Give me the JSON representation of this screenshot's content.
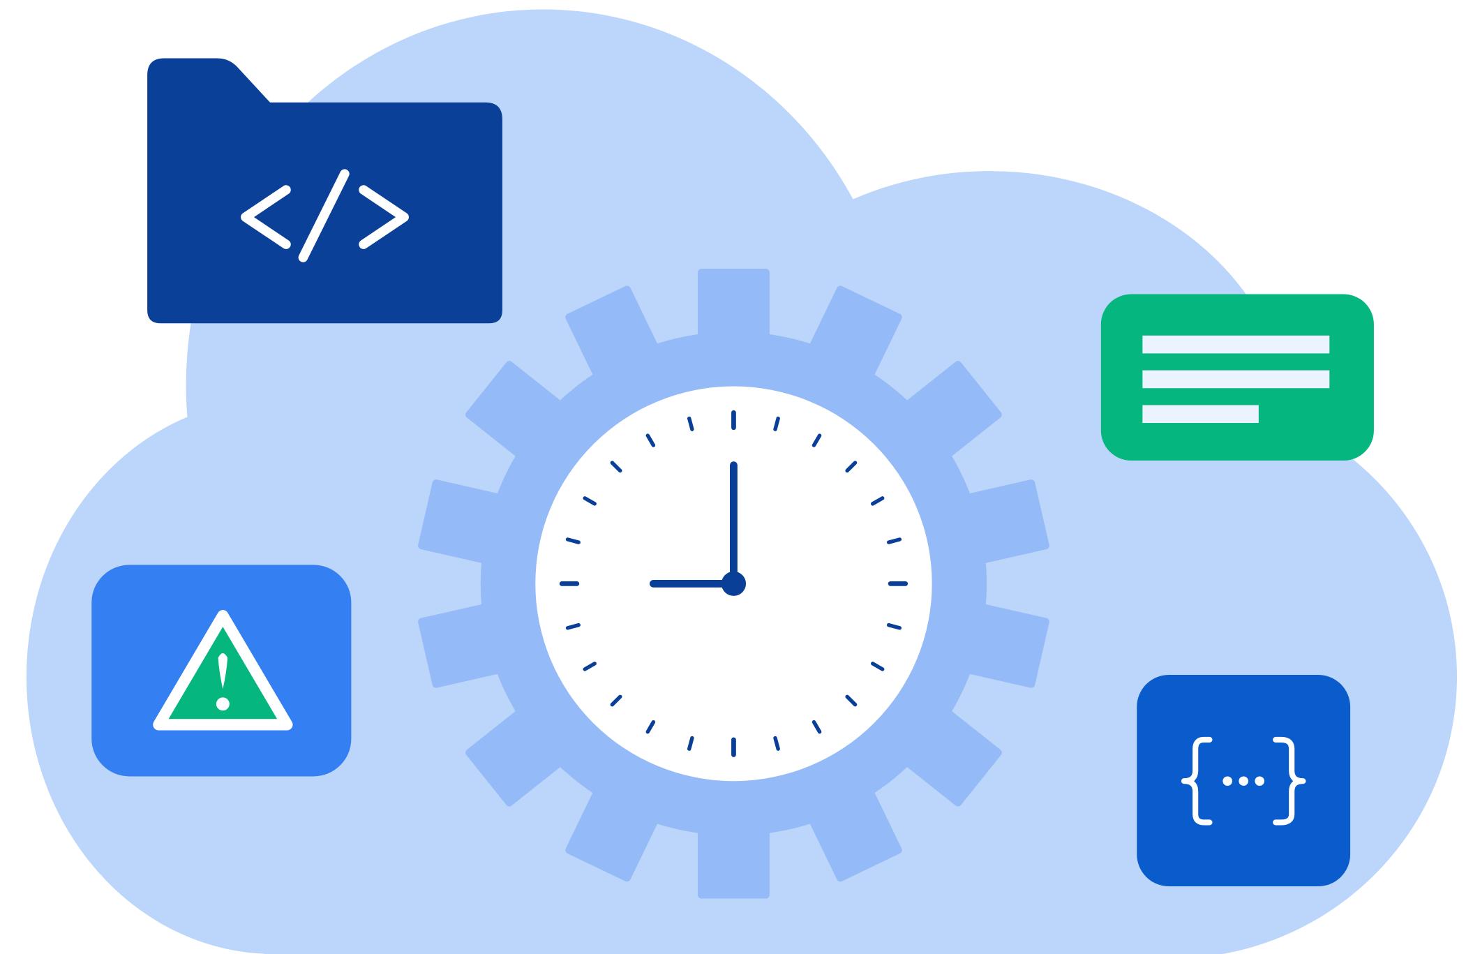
{
  "colors": {
    "background": "#FFFFFF",
    "cloud": "#BCD5FA",
    "gear": "#94BAF7",
    "clock_face": "#FFFFFF",
    "clock_marks": "#0A3F97",
    "folder": "#0A4097",
    "alert_card": "#3480F2",
    "alert_triangle": "#05B67E",
    "text_card": "#05B67E",
    "text_card_lines": "#EBF3FE",
    "code_card": "#0A5BCC",
    "icon_stroke": "#FFFFFF"
  },
  "icons": {
    "cloud": "cloud-shape",
    "gear": "gear-icon",
    "clock": "clock-icon",
    "folder": "code-folder-icon",
    "code_symbol": "code-brackets-icon",
    "alert": "warning-triangle-icon",
    "text_lines": "text-lines-icon",
    "json": "curly-braces-icon"
  },
  "clock": {
    "time_shown": "9:00",
    "hour": 9,
    "minute": 0
  }
}
